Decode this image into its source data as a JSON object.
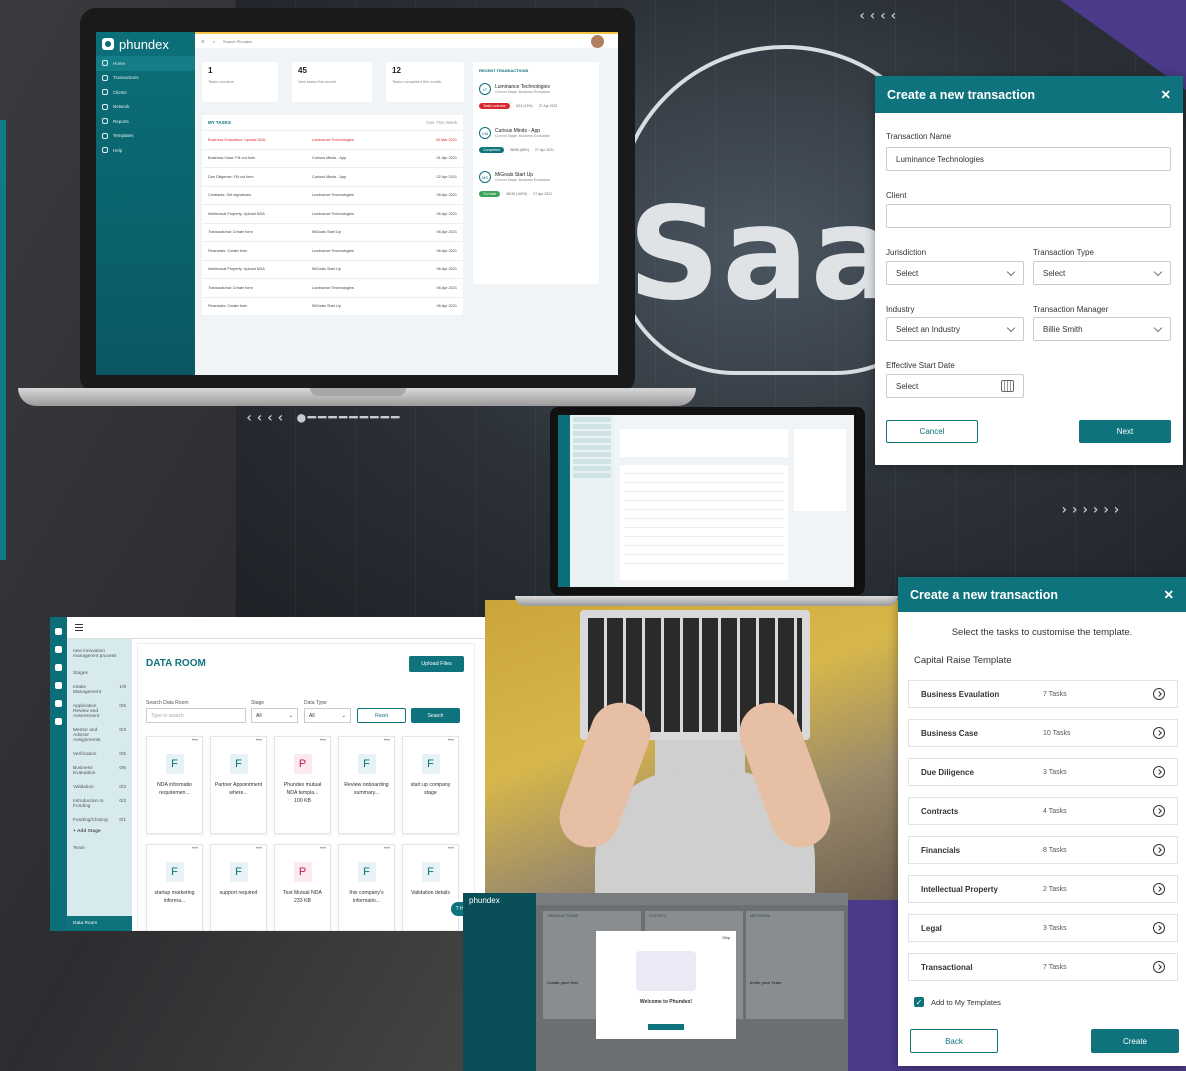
{
  "brand": "phundex",
  "laptop1": {
    "search_placeholder": "Search Phundex",
    "nav": [
      "Home",
      "Transactions",
      "Clients",
      "Network",
      "Reports",
      "Templates",
      "Help"
    ],
    "stats": [
      {
        "value": "1",
        "label": "Tasks overdue"
      },
      {
        "value": "45",
        "label": "New tasks this month"
      },
      {
        "value": "12",
        "label": "Tasks completed this month"
      }
    ],
    "my_tasks_title": "MY TASKS",
    "my_tasks_filter": "Due This Week",
    "tasks": [
      {
        "task": "Business Evaluation: Upload NDA",
        "client": "Luminance Technologies",
        "date": "30 Mar 2021"
      },
      {
        "task": "Business Case: Fill out form",
        "client": "Curious Minds - App",
        "date": "01 Apr 2021"
      },
      {
        "task": "Due Diligence: Fill out form",
        "client": "Curious Minds - App",
        "date": "02 Apr 2021"
      },
      {
        "task": "Contracts: Get signatures",
        "client": "Luminance Technologies",
        "date": "05 Apr 2021"
      },
      {
        "task": "Intellectual Property: Upload NDA",
        "client": "Luminance Technologies",
        "date": "06 Apr 2021"
      },
      {
        "task": "Transactional: Create form",
        "client": "MiGoals Start Up",
        "date": "06 Apr 2021"
      },
      {
        "task": "Financials: Create form",
        "client": "Luminance Technologies",
        "date": "06 Apr 2021"
      },
      {
        "task": "Intellectual Property: Upload NDA",
        "client": "MiGoals Start Up",
        "date": "06 Apr 2021"
      },
      {
        "task": "Transactional: Create form",
        "client": "Luminance Technologies",
        "date": "06 Apr 2021"
      },
      {
        "task": "Financials: Create form",
        "client": "MiGoals Start Up",
        "date": "06 Apr 2021"
      }
    ],
    "recent_title": "RECENT TRANSACTIONS",
    "recent": [
      {
        "initials": "LT",
        "name": "Luminance Technologies",
        "stage": "Current Stage: Business Evaluation",
        "badge": "Tasks overdue",
        "badge_color": "#d8282f",
        "tasks": "3/24 (13%)",
        "date": "27 Apr 2021"
      },
      {
        "initials": "CM",
        "name": "Curious Minds - App",
        "stage": "Current Stage: Business Evaluation",
        "badge": "Completed",
        "badge_color": "#0e737c",
        "tasks": "38/55 (68%)",
        "date": "27 Apr 2021"
      },
      {
        "initials": "MS",
        "name": "MiGoals Start Up",
        "stage": "Current Stage: Business Evaluation",
        "badge": "On track",
        "badge_color": "#3aa35b",
        "tasks": "38/38 (100%)",
        "date": "27 Apr 2021"
      }
    ]
  },
  "dialog1": {
    "title": "Create a new transaction",
    "close": "✕",
    "transaction_name_label": "Transaction Name",
    "transaction_name_value": "Luminance Technologies",
    "client_label": "Client",
    "client_value": "",
    "jurisdiction_label": "Jurisdiction",
    "jurisdiction_value": "Select",
    "type_label": "Transaction Type",
    "type_value": "Select",
    "industry_label": "Industry",
    "industry_value": "Select an Industry",
    "manager_label": "Transaction Manager",
    "manager_value": "Billie Smith",
    "start_label": "Effective Start Date",
    "start_value": "Select",
    "cancel": "Cancel",
    "next": "Next"
  },
  "dialog2": {
    "title": "Create a new transaction",
    "close": "✕",
    "intro": "Select the tasks to customise the template.",
    "template": "Capital Raise Template",
    "rows": [
      {
        "name": "Business Evaulation",
        "count": "7 Tasks"
      },
      {
        "name": "Business Case",
        "count": "10 Tasks"
      },
      {
        "name": "Due Diligence",
        "count": "3 Tasks"
      },
      {
        "name": "Contracts",
        "count": "4 Tasks"
      },
      {
        "name": "Financials",
        "count": "8 Tasks"
      },
      {
        "name": "Intellectual Property",
        "count": "2 Tasks"
      },
      {
        "name": "Legal",
        "count": "3 Tasks"
      },
      {
        "name": "Transactional",
        "count": "7 Tasks"
      }
    ],
    "add_to_templates": "Add to My Templates",
    "back": "Back",
    "create": "Create"
  },
  "dataroom": {
    "process": "new innovation managemnt process",
    "stages_label": "Stages",
    "stages": [
      {
        "name": "Intake Management",
        "count": "1/9"
      },
      {
        "name": "Application Review and Assessment",
        "count": "0/6"
      },
      {
        "name": "Mentor and Advisor Assignments",
        "count": "0/3"
      },
      {
        "name": "Verification",
        "count": "0/5"
      },
      {
        "name": "Business Evaluation",
        "count": "0/6"
      },
      {
        "name": "Validation",
        "count": "0/3"
      },
      {
        "name": "Introduction to Funding",
        "count": "0/2"
      },
      {
        "name": "Funding/Closing",
        "count": "0/1"
      }
    ],
    "add_stage": "+ Add Stage",
    "team": "Team",
    "data_room_nav": "Data Room",
    "title": "DATA ROOM",
    "upload": "Upload Files",
    "search_label": "Search Data Room",
    "search_placeholder": "Type to search",
    "stage_label": "Stage",
    "stage_value": "All",
    "type_label": "Data Type",
    "type_value": "All",
    "reset": "Reset",
    "search": "Search",
    "files": [
      {
        "icon": "F",
        "name": "NDA informatio requiremen...",
        "size": ""
      },
      {
        "icon": "F",
        "name": "Partner Appointment where...",
        "size": ""
      },
      {
        "icon": "P",
        "name": "Phundex mutual NDA templa...",
        "size": "100 KB"
      },
      {
        "icon": "F",
        "name": "Review onboarding summary...",
        "size": ""
      },
      {
        "icon": "F",
        "name": "start up company stage",
        "size": ""
      },
      {
        "icon": "F",
        "name": "startup marketing informa...",
        "size": ""
      },
      {
        "icon": "F",
        "name": "support required",
        "size": ""
      },
      {
        "icon": "P",
        "name": "Test Mutual NDA",
        "size": "233 KB"
      },
      {
        "icon": "F",
        "name": "this company's informatio...",
        "size": ""
      },
      {
        "icon": "F",
        "name": "Validation details",
        "size": ""
      }
    ],
    "help": "Help"
  },
  "onboarding": {
    "brand": "phundex",
    "cols": [
      "TRANSACTIONS",
      "CLIENTS",
      "NETWORK"
    ],
    "welcome": "Welcome to Phundex!",
    "skip": "Skip",
    "create_first": "Create your first",
    "invite_team": "Invite your Team"
  },
  "backdrop": {
    "word": "SaaS"
  }
}
